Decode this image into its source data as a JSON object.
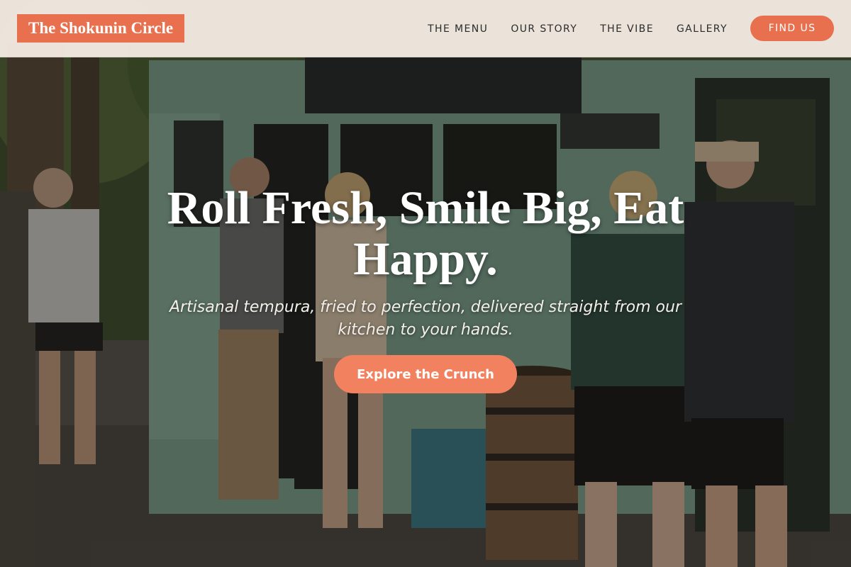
{
  "brand": {
    "name": "The Shokunin Circle"
  },
  "nav": {
    "links": [
      {
        "label": "THE MENU"
      },
      {
        "label": "OUR STORY"
      },
      {
        "label": "THE VIBE"
      },
      {
        "label": "GALLERY"
      }
    ],
    "cta_label": "FIND US"
  },
  "hero": {
    "headline": "Roll Fresh, Smile Big, Eat Happy.",
    "subheadline": "Artisanal tempura, fried to perfection, delivered straight from our kitchen to your hands.",
    "cta_label": "Explore the Crunch"
  },
  "colors": {
    "accent": "#e8704e",
    "cta_button": "#f2825f",
    "navbar_bg": "#faf0e8"
  }
}
